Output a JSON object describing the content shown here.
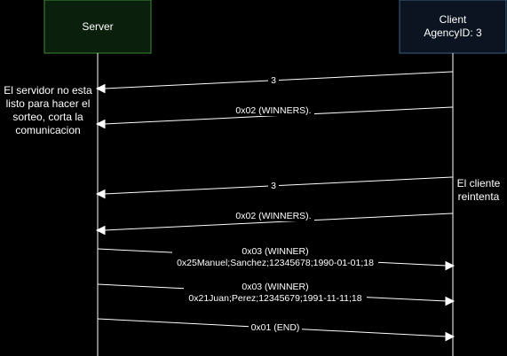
{
  "participants": {
    "server": {
      "label": "Server",
      "fill": "#0b1f0d",
      "stroke": "#3f8a3a"
    },
    "client": {
      "label_line1": "Client",
      "label_line2": "AgencyID: 3",
      "fill": "#0b1420",
      "stroke": "#3e5f86"
    }
  },
  "notes": {
    "server_note": [
      "El servidor no esta",
      "listo para hacer el",
      "sorteo, corta la",
      "comunicacion"
    ],
    "client_note": [
      "El cliente",
      "reintenta"
    ]
  },
  "messages": [
    {
      "id": "msg-1",
      "direction": "to-server",
      "lines": [
        "3"
      ]
    },
    {
      "id": "msg-2",
      "direction": "to-server",
      "lines": [
        "0x02 (WINNERS)."
      ]
    },
    {
      "id": "msg-3",
      "direction": "to-server",
      "lines": [
        "3"
      ]
    },
    {
      "id": "msg-4",
      "direction": "to-server",
      "lines": [
        "0x02 (WINNERS)."
      ]
    },
    {
      "id": "msg-5",
      "direction": "to-client",
      "lines": [
        "0x03 (WINNER)",
        "0x25Manuel;Sanchez;12345678;1990-01-01;18"
      ]
    },
    {
      "id": "msg-6",
      "direction": "to-client",
      "lines": [
        "0x03 (WINNER)",
        "0x21Juan;Perez;12345679;1991-11-11;18"
      ]
    },
    {
      "id": "msg-7",
      "direction": "to-client",
      "lines": [
        "0x01 (END)"
      ]
    }
  ]
}
